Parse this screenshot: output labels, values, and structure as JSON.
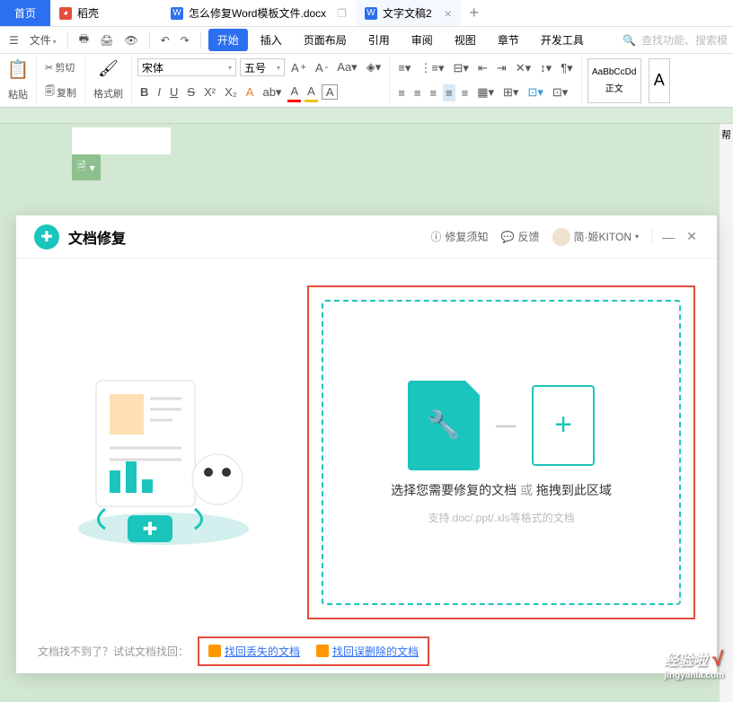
{
  "tabs": {
    "home": "首页",
    "dao": "稻壳",
    "doc1": "怎么修复Word模板文件.docx",
    "doc2": "文字文稿2",
    "doc2_close": "×",
    "new": "+"
  },
  "menu": {
    "file": "文件",
    "start": "开始",
    "insert": "插入",
    "layout": "页面布局",
    "ref": "引用",
    "review": "审阅",
    "view": "视图",
    "chapter": "章节",
    "devtools": "开发工具",
    "search_ph": "查找功能、搜索模"
  },
  "ribbon": {
    "paste": "粘贴",
    "cut": "剪切",
    "copy": "复制",
    "format": "格式刷",
    "font": "宋体",
    "size": "五号",
    "bold": "B",
    "italic": "I",
    "underline": "U",
    "strike": "S",
    "sup": "X²",
    "sub": "X₂",
    "a_color": "A",
    "style_name": "AaBbCcDd",
    "style_label": "正文",
    "style_a": "A"
  },
  "side": {
    "help": "帮"
  },
  "modal": {
    "title": "文档修复",
    "notice": "修复须知",
    "feedback": "反馈",
    "user": "简·姬KITON",
    "dz_line1_a": "选择您需要修复的文档",
    "dz_line1_b": "或",
    "dz_line1_c": "拖拽到此区域",
    "dz_line2": "支持.doc/.ppt/.xls等格式的文档",
    "footer_lead": "文档找不到了？试试文档找回：",
    "link1": "找回丢失的文档",
    "link2": "找回误删除的文档"
  },
  "watermark": {
    "main": "经验啦",
    "sub": "jingyanla.com"
  }
}
